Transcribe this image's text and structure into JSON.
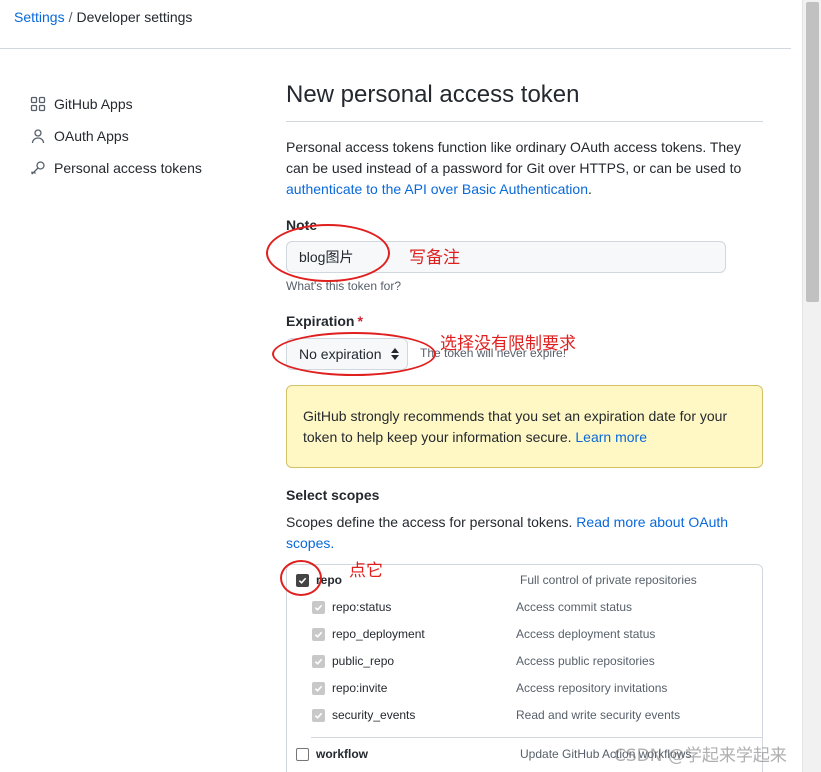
{
  "breadcrumb": {
    "settings": "Settings",
    "separator": "/",
    "current": "Developer settings"
  },
  "sidebar": {
    "items": [
      {
        "label": "GitHub Apps",
        "icon": "apps-icon"
      },
      {
        "label": "OAuth Apps",
        "icon": "person-icon"
      },
      {
        "label": "Personal access tokens",
        "icon": "key-icon"
      }
    ]
  },
  "main": {
    "title": "New personal access token",
    "intro_text": "Personal access tokens function like ordinary OAuth access tokens. They can be used instead of a password for Git over HTTPS, or can be used to",
    "intro_link": "authenticate to the API over Basic Authentication",
    "intro_end": ".",
    "note": {
      "label": "Note",
      "value": "blog图片",
      "hint": "What's this token for?"
    },
    "expiration": {
      "label": "Expiration",
      "required_mark": "*",
      "selected": "No expiration",
      "hint": "The token will never expire!"
    },
    "warning": {
      "text": "GitHub strongly recommends that you set an expiration date for your token to help keep your information secure.",
      "link": "Learn more"
    },
    "scopes": {
      "label": "Select scopes",
      "desc_text": "Scopes define the access for personal tokens.",
      "desc_link": "Read more about OAuth scopes.",
      "items": [
        {
          "name": "repo",
          "desc": "Full control of private repositories",
          "checked": true,
          "level": "parent"
        },
        {
          "name": "repo:status",
          "desc": "Access commit status",
          "checked": true,
          "level": "child"
        },
        {
          "name": "repo_deployment",
          "desc": "Access deployment status",
          "checked": true,
          "level": "child"
        },
        {
          "name": "public_repo",
          "desc": "Access public repositories",
          "checked": true,
          "level": "child"
        },
        {
          "name": "repo:invite",
          "desc": "Access repository invitations",
          "checked": true,
          "level": "child"
        },
        {
          "name": "security_events",
          "desc": "Read and write security events",
          "checked": true,
          "level": "child"
        },
        {
          "name": "workflow",
          "desc": "Update GitHub Action workflows",
          "checked": false,
          "level": "parent"
        }
      ]
    }
  },
  "annotations": {
    "note": "写备注",
    "expiration": "选择没有限制要求",
    "repo": "点它",
    "color": "#e0201f"
  },
  "watermark": "CSDN @学起来学起来"
}
